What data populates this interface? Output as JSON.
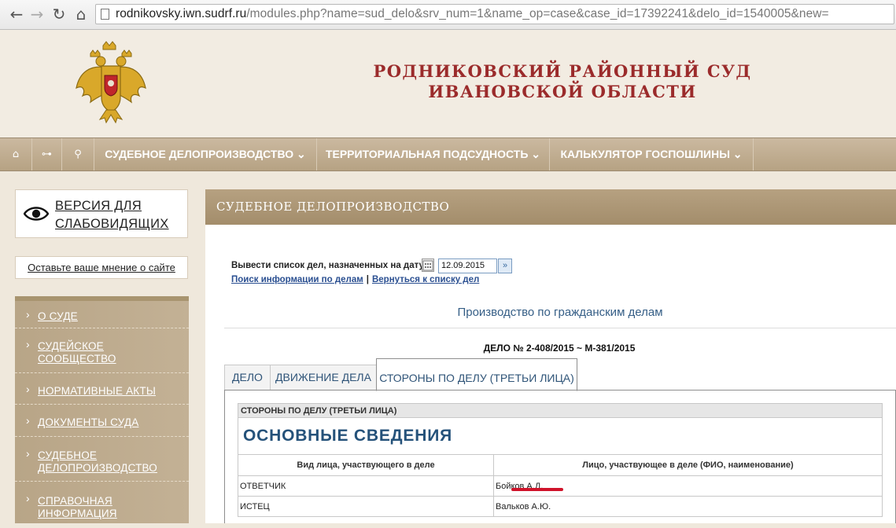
{
  "browser": {
    "back_icon": "arrow-left",
    "forward_icon": "arrow-right",
    "reload_icon": "reload",
    "home_icon": "home",
    "url_host": "rodnikovsky.iwn.sudrf.ru",
    "url_path": "/modules.php?name=sud_delo&srv_num=1&name_op=case&case_id=17392241&delo_id=1540005&new="
  },
  "header": {
    "title_line1": "РОДНИКОВСКИЙ РАЙОННЫЙ СУД",
    "title_line2": "ИВАНОВСКОЙ ОБЛАСТИ"
  },
  "menu": {
    "home_icon": "⌂",
    "sitemap_icon": "⊶",
    "search_icon": "⚲",
    "items": [
      {
        "label": "СУДЕБНОЕ ДЕЛОПРОИЗВОДСТВО ⌄"
      },
      {
        "label": "ТЕРРИТОРИАЛЬНАЯ ПОДСУДНОСТЬ ⌄"
      },
      {
        "label": "КАЛЬКУЛЯТОР ГОСПОШЛИНЫ ⌄"
      }
    ]
  },
  "sidebar": {
    "accessibility_line1": "ВЕРСИЯ ДЛЯ",
    "accessibility_line2": "СЛАБОВИДЯЩИХ",
    "feedback": "Оставьте ваше мнение о сайте",
    "items": [
      {
        "line1": "О СУДЕ",
        "line2": ""
      },
      {
        "line1": "СУДЕЙСКОЕ",
        "line2": "СООБЩЕСТВО"
      },
      {
        "line1": "НОРМАТИВНЫЕ АКТЫ",
        "line2": ""
      },
      {
        "line1": "ДОКУМЕНТЫ СУДА",
        "line2": ""
      },
      {
        "line1": "СУДЕБНОЕ",
        "line2": "ДЕЛОПРОИЗВОДСТВО"
      },
      {
        "line1": "СПРАВОЧНАЯ",
        "line2": "ИНФОРМАЦИЯ"
      }
    ]
  },
  "content": {
    "header": "СУДЕБНОЕ ДЕЛОПРОИЗВОДСТВО",
    "date_label": "Вывести список дел, назначенных на дату",
    "date_value": "12.09.2015",
    "go_symbol": "»",
    "link_search": "Поиск информации по делам",
    "link_separator": "|",
    "link_back": "Вернуться к списку дел",
    "section_title": "Производство по гражданским делам",
    "case_number": "ДЕЛО № 2-408/2015 ~ М-381/2015",
    "tabs": [
      {
        "label": "ДЕЛО"
      },
      {
        "label": "ДВИЖЕНИЕ ДЕЛА"
      },
      {
        "label": "СТОРОНЫ ПО ДЕЛУ (ТРЕТЬИ ЛИЦА)"
      }
    ],
    "table": {
      "caption": "СТОРОНЫ ПО ДЕЛУ (ТРЕТЬИ ЛИЦА)",
      "heading": "ОСНОВНЫЕ СВЕДЕНИЯ",
      "columns": [
        "Вид лица, участвующего в деле",
        "Лицо, участвующее в деле (ФИО, наименование)"
      ],
      "rows": [
        [
          "ОТВЕТЧИК",
          "Бойков А.Д."
        ],
        [
          "ИСТЕЦ",
          "Вальков А.Ю."
        ]
      ]
    }
  },
  "colors": {
    "title_red": "#9b2b2b",
    "menu_bg": "#b6a283",
    "link_blue": "#2a4f91",
    "heading_blue": "#25527a",
    "annotation_red": "#d0132a"
  }
}
